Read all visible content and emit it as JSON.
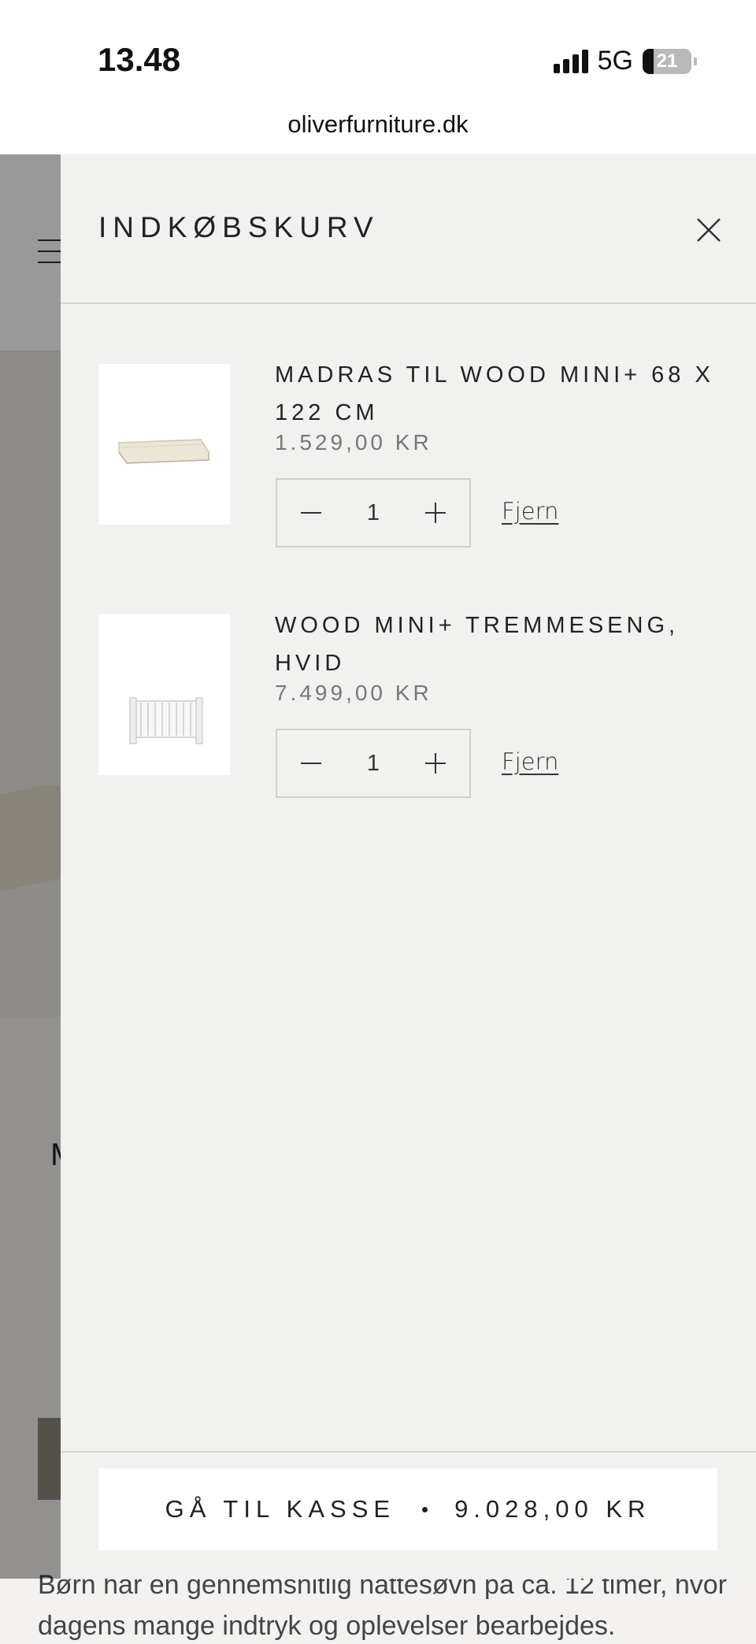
{
  "status_bar": {
    "time": "13.48",
    "network": "5G",
    "battery": "21"
  },
  "browser": {
    "url": "oliverfurniture.dk"
  },
  "background_page": {
    "partial_heading": "M",
    "body_text": "Børn har en gennemsnitlig nattesøvn på ca. 12 timer, hvor dagens mange indtryk og oplevelser bearbejdes."
  },
  "cart": {
    "title": "INDKØBSKURV",
    "items": [
      {
        "name": "MADRAS TIL WOOD MINI+ 68 X 122 CM",
        "price": "1.529,00 KR",
        "quantity": "1",
        "remove_label": "Fjern",
        "image_icon": "mattress-image"
      },
      {
        "name": "WOOD MINI+ TREMMESENG, HVID",
        "price": "7.499,00 KR",
        "quantity": "1",
        "remove_label": "Fjern",
        "image_icon": "crib-image"
      }
    ],
    "checkout": {
      "label": "GÅ TIL KASSE",
      "total": "9.028,00 KR"
    }
  }
}
